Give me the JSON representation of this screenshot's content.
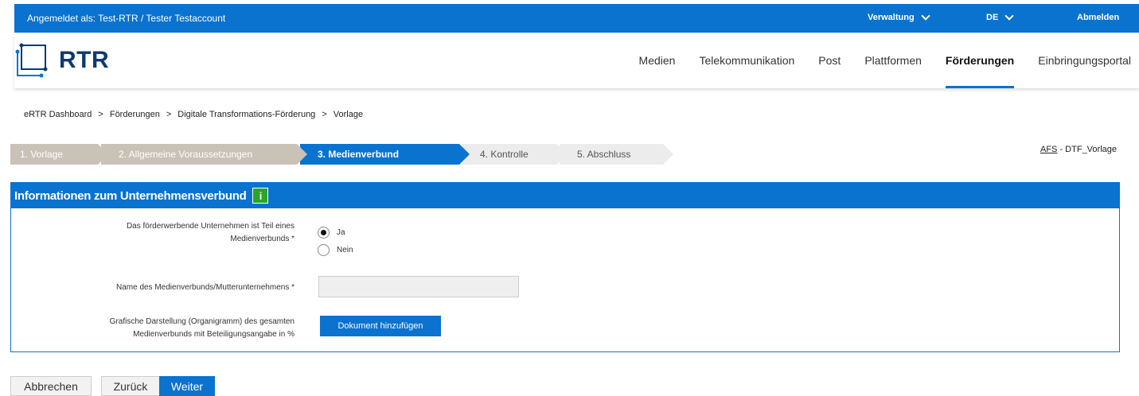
{
  "topbar": {
    "logged_in_as": "Angemeldet als: Test-RTR / Tester Testaccount",
    "admin_menu": "Verwaltung",
    "language": "DE",
    "logout": "Abmelden"
  },
  "header": {
    "logo_text": "RTR",
    "nav": [
      {
        "label": "Medien"
      },
      {
        "label": "Telekommunikation"
      },
      {
        "label": "Post"
      },
      {
        "label": "Plattformen"
      },
      {
        "label": "Förderungen",
        "active": true
      },
      {
        "label": "Einbringungsportal"
      }
    ]
  },
  "breadcrumb": [
    "eRTR Dashboard",
    "Förderungen",
    "Digitale Transformations-Förderung",
    "Vorlage"
  ],
  "breadcrumb_separator": ">",
  "steps": [
    {
      "label": "1. Vorlage",
      "state": "done"
    },
    {
      "label": "2. Allgemeine Voraussetzungen",
      "state": "done"
    },
    {
      "label": "3. Medienverbund",
      "state": "current"
    },
    {
      "label": "4. Kontrolle",
      "state": "todo"
    },
    {
      "label": "5. Abschluss",
      "state": "todo"
    }
  ],
  "form_code": {
    "link": "AFS",
    "rest": " - DTF_Vorlage"
  },
  "panel": {
    "title": "Informationen zum Unternehmensverbund",
    "info_icon": "i",
    "q1_label_line1": "Das förderwerbende Unternehmen ist Teil eines",
    "q1_label_line2": "Medienverbunds  *",
    "q1_options": [
      {
        "label": "Ja",
        "selected": true
      },
      {
        "label": "Nein",
        "selected": false
      }
    ],
    "q2_label": "Name des Medienverbunds/Mutterunternehmens  *",
    "q2_value": "",
    "q3_label_line1": "Grafische Darstellung (Organigramm) des gesamten",
    "q3_label_line2": "Medienverbunds mit Beteiligungsangabe in %",
    "q3_button": "Dokument hinzufügen"
  },
  "footer": {
    "cancel": "Abbrechen",
    "back": "Zurück",
    "next": "Weiter"
  },
  "colors": {
    "primary": "#0a72cf",
    "step_done": "#c9c2b6",
    "step_todo": "#ececec",
    "info_green": "#2aa52a"
  }
}
